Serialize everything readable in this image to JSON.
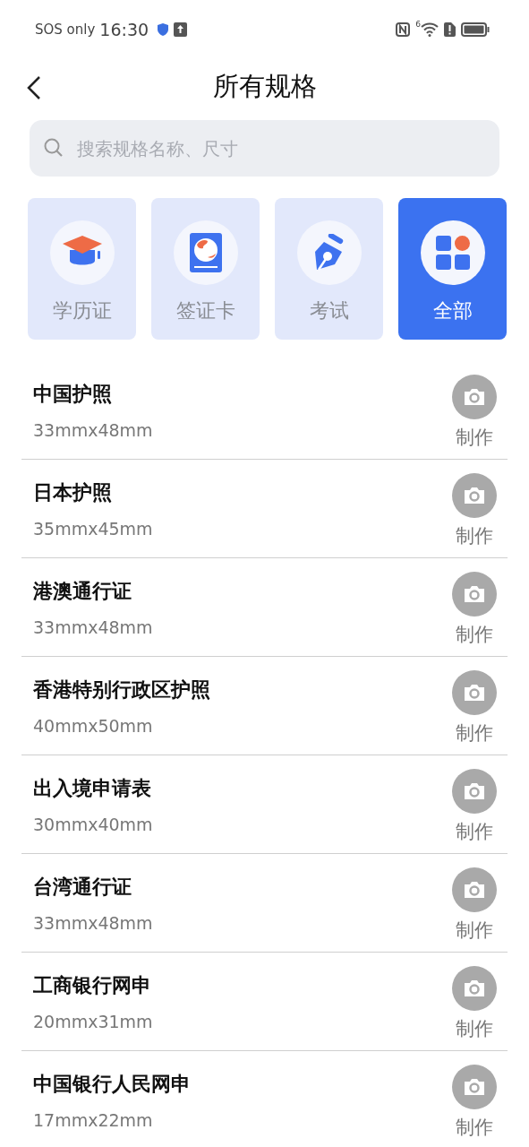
{
  "status_bar": {
    "carrier": "SOS only",
    "time": "16:30",
    "wifi_label": "6"
  },
  "header": {
    "title": "所有规格"
  },
  "search": {
    "placeholder": "搜索规格名称、尺寸"
  },
  "categories": [
    {
      "kind": "cap",
      "label": "学历证",
      "selected": false
    },
    {
      "kind": "passport",
      "label": "签证卡",
      "selected": false
    },
    {
      "kind": "pen",
      "label": "考试",
      "selected": false
    },
    {
      "kind": "grid",
      "label": "全部",
      "selected": true
    }
  ],
  "specs": [
    {
      "name": "中国护照",
      "size": "33mmx48mm",
      "action": "制作"
    },
    {
      "name": "日本护照",
      "size": "35mmx45mm",
      "action": "制作"
    },
    {
      "name": "港澳通行证",
      "size": "33mmx48mm",
      "action": "制作"
    },
    {
      "name": "香港特别行政区护照",
      "size": "40mmx50mm",
      "action": "制作"
    },
    {
      "name": "出入境申请表",
      "size": "30mmx40mm",
      "action": "制作"
    },
    {
      "name": "台湾通行证",
      "size": "33mmx48mm",
      "action": "制作"
    },
    {
      "name": "工商银行网申",
      "size": "20mmx31mm",
      "action": "制作"
    },
    {
      "name": "中国银行人民网申",
      "size": "17mmx22mm",
      "action": "制作"
    }
  ]
}
